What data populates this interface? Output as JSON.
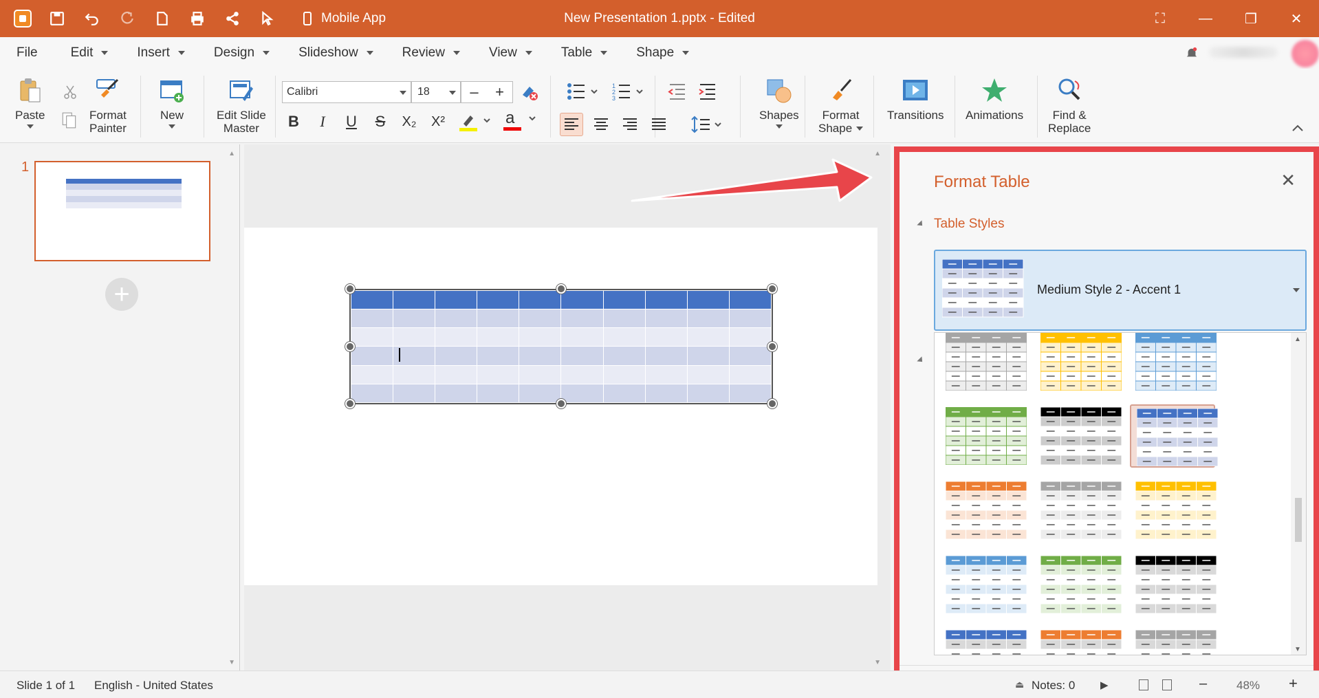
{
  "titlebar": {
    "mobile_app": "Mobile App",
    "title": "New Presentation 1.pptx - Edited"
  },
  "menu": {
    "items": [
      "File",
      "Edit",
      "Insert",
      "Design",
      "Slideshow",
      "Review",
      "View",
      "Table",
      "Shape"
    ]
  },
  "ribbon": {
    "paste": "Paste",
    "format_painter_1": "Format",
    "format_painter_2": "Painter",
    "new": "New",
    "edit_slide_1": "Edit Slide",
    "edit_slide_2": "Master",
    "font": "Calibri",
    "size": "18",
    "shapes": "Shapes",
    "format_shape_1": "Format",
    "format_shape_2": "Shape",
    "transitions": "Transitions",
    "animations": "Animations",
    "find_1": "Find &",
    "find_2": "Replace",
    "bold": "B",
    "italic": "I",
    "underline": "U",
    "strike": "S",
    "subscript": "X₂",
    "superscript": "X²",
    "font_color_glyph": "a"
  },
  "slides_panel": {
    "slide_number": "1"
  },
  "format_panel": {
    "title": "Format Table",
    "section": "Table Styles",
    "selected_style": "Medium Style 2 - Accent 1"
  },
  "status": {
    "slide": "Slide 1 of 1",
    "language": "English - United States",
    "notes": "Notes: 0",
    "zoom": "48%"
  },
  "colors": {
    "brand": "#d35f2c",
    "highlight_frame": "#e8454a",
    "accent1": "#4472c4"
  },
  "gallery_styles": [
    {
      "header": "#a5a5a5",
      "band": "#ededed",
      "border": "#a5a5a5"
    },
    {
      "header": "#ffc000",
      "band": "#fff2cc",
      "border": "#ffc000"
    },
    {
      "header": "#5b9bd5",
      "band": "#deebf7",
      "border": "#5b9bd5"
    },
    {
      "header": "#70ad47",
      "band": "#e2efd9",
      "border": "#70ad47"
    },
    {
      "header": "#000000",
      "band": "#cccccc",
      "border": "#ffffff"
    },
    {
      "header": "#4472c4",
      "band": "#cfd5ea",
      "border": "#ffffff"
    },
    {
      "header": "#ed7d31",
      "band": "#fbe4d5",
      "border": "#ffffff"
    },
    {
      "header": "#a5a5a5",
      "band": "#ededed",
      "border": "#ffffff"
    },
    {
      "header": "#ffc000",
      "band": "#fff2cc",
      "border": "#ffffff"
    },
    {
      "header": "#5b9bd5",
      "band": "#deebf7",
      "border": "#ffffff"
    },
    {
      "header": "#70ad47",
      "band": "#e2efd9",
      "border": "#ffffff"
    },
    {
      "header": "#000000",
      "band": "#d9d9d9",
      "border": "#ffffff"
    },
    {
      "header": "#4472c4",
      "band": "#d9d9d9",
      "border": "#ffffff"
    },
    {
      "header": "#ed7d31",
      "band": "#d9d9d9",
      "border": "#ffffff"
    },
    {
      "header": "#a5a5a5",
      "band": "#d9d9d9",
      "border": "#ffffff"
    }
  ]
}
